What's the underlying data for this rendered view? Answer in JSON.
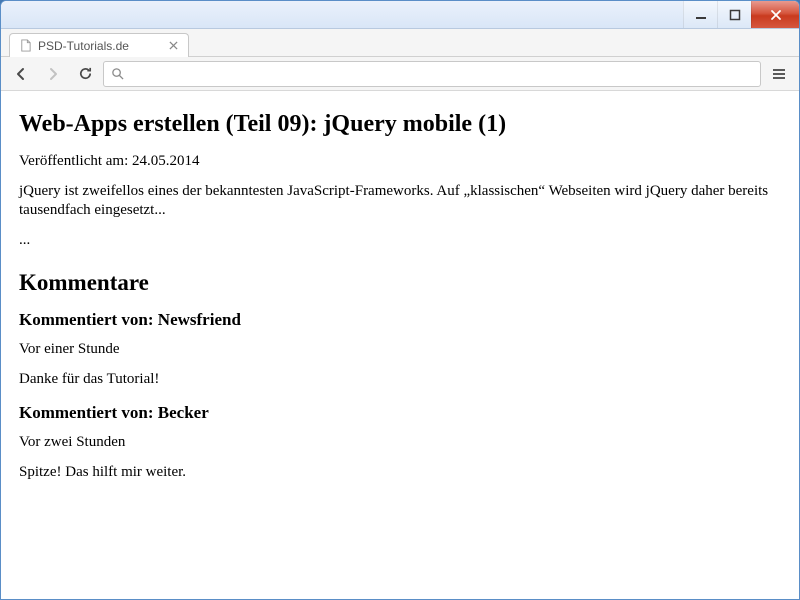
{
  "window": {
    "tab_title": "PSD-Tutorials.de"
  },
  "omnibox": {
    "value": ""
  },
  "article": {
    "title": "Web-Apps erstellen (Teil 09): jQuery mobile (1)",
    "published": "Veröffentlicht am: 24.05.2014",
    "intro": "jQuery ist zweifellos eines der bekanntesten JavaScript-Frameworks. Auf „klassischen“ Webseiten wird jQuery daher bereits tausendfach eingesetzt...",
    "ellipsis": "...",
    "comments_heading": "Kommentare",
    "comments": [
      {
        "by_label": "Kommentiert von: Newsfriend",
        "time": "Vor einer Stunde",
        "body": "Danke für das Tutorial!"
      },
      {
        "by_label": "Kommentiert von: Becker",
        "time": "Vor zwei Stunden",
        "body": "Spitze! Das hilft mir weiter."
      }
    ]
  }
}
